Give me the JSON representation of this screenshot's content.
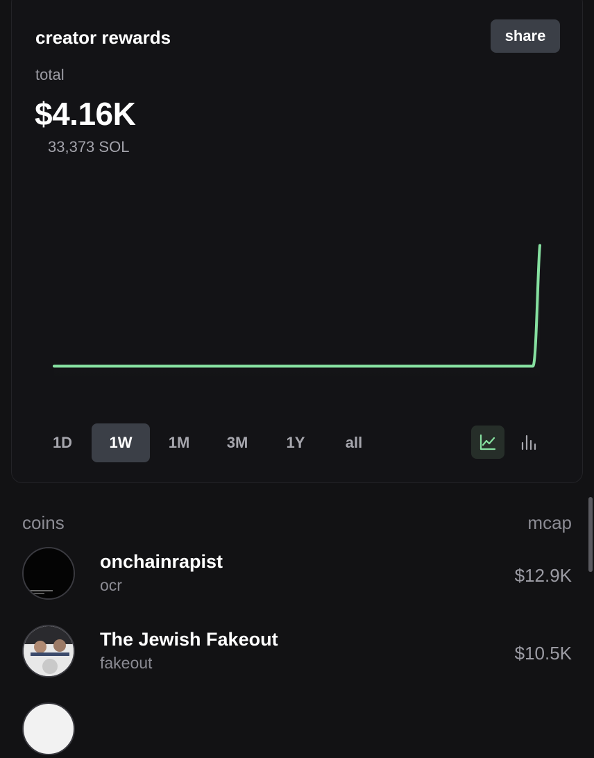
{
  "card": {
    "title": "creator rewards",
    "share_label": "share",
    "total_label": "total",
    "total_usd": "$4.16K",
    "total_sol": "33,373 SOL"
  },
  "chart_data": {
    "type": "area",
    "x": [
      0,
      1,
      2,
      3,
      4,
      5,
      6,
      6.9,
      7
    ],
    "values": [
      0.38,
      0.38,
      0.38,
      0.38,
      0.38,
      0.38,
      0.38,
      0.38,
      4.16
    ],
    "ylim": [
      0,
      5
    ],
    "line_color": "#86e0a0",
    "grid": false
  },
  "ranges": [
    "1D",
    "1W",
    "1M",
    "3M",
    "1Y",
    "all"
  ],
  "active_range": "1W",
  "view": {
    "active": "line",
    "icons": [
      "line-chart-icon",
      "bar-chart-icon"
    ]
  },
  "coins": {
    "header_left": "coins",
    "header_right": "mcap",
    "items": [
      {
        "name": "onchainrapist",
        "ticker": "ocr",
        "mcap": "$12.9K"
      },
      {
        "name": "The Jewish Fakeout",
        "ticker": "fakeout",
        "mcap": "$10.5K"
      },
      {
        "name": "",
        "ticker": "",
        "mcap": ""
      }
    ]
  },
  "colors": {
    "accent": "#86e0a0",
    "button_bg": "#3b3f47",
    "background": "#121214"
  }
}
